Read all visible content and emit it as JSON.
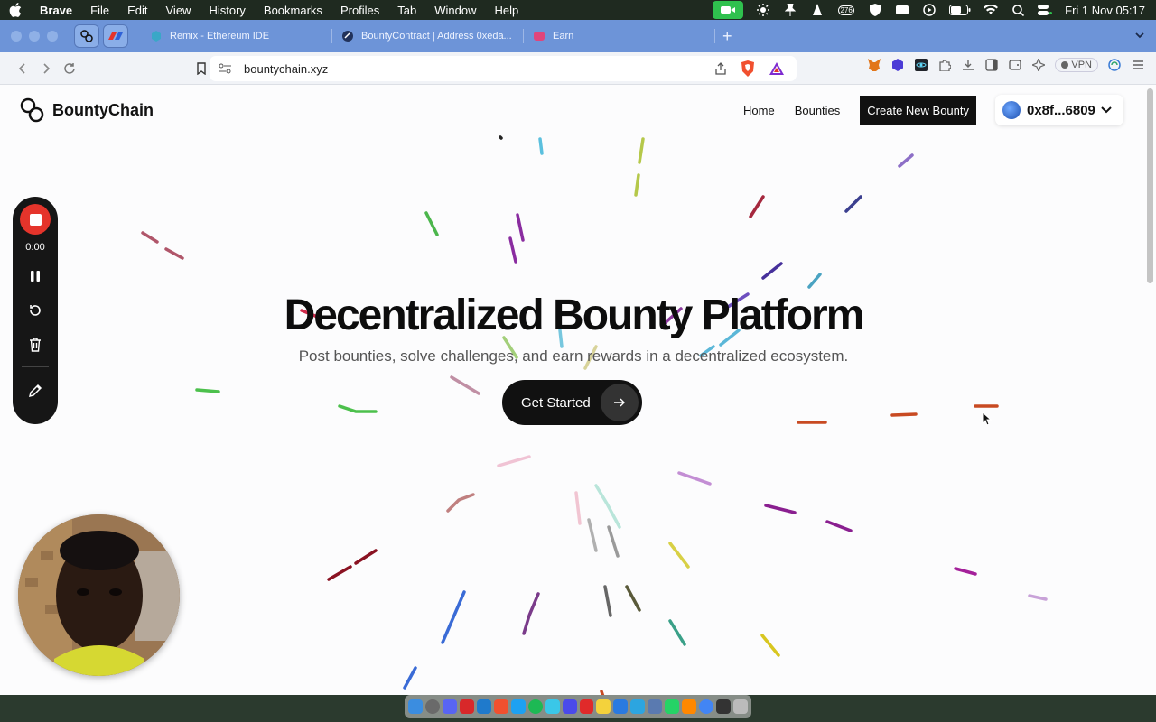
{
  "menubar": {
    "app_name": "Brave",
    "items": [
      "File",
      "Edit",
      "View",
      "History",
      "Bookmarks",
      "Profiles",
      "Tab",
      "Window",
      "Help"
    ],
    "notif_count": "276",
    "clock": "Fri 1 Nov  05:17"
  },
  "browser": {
    "tabs": [
      {
        "label": "Remix - Ethereum IDE"
      },
      {
        "label": "BountyContract | Address 0xeda..."
      },
      {
        "label": "Earn"
      }
    ],
    "url": "bountychain.xyz",
    "vpn_label": "VPN"
  },
  "site": {
    "logo_text": "BountyChain",
    "nav": {
      "home": "Home",
      "bounties": "Bounties",
      "create": "Create New Bounty"
    },
    "wallet_address": "0x8f...6809",
    "hero": {
      "title": "Decentralized Bounty Platform",
      "subtitle": "Post bounties, solve challenges, and earn rewards in a decentralized ecosystem.",
      "cta_label": "Get Started"
    }
  },
  "recorder": {
    "time": "0:00"
  },
  "colors": {
    "tabbar": "#6d94d8",
    "record_red": "#e5342b",
    "facetime_green": "#2fc14e"
  }
}
